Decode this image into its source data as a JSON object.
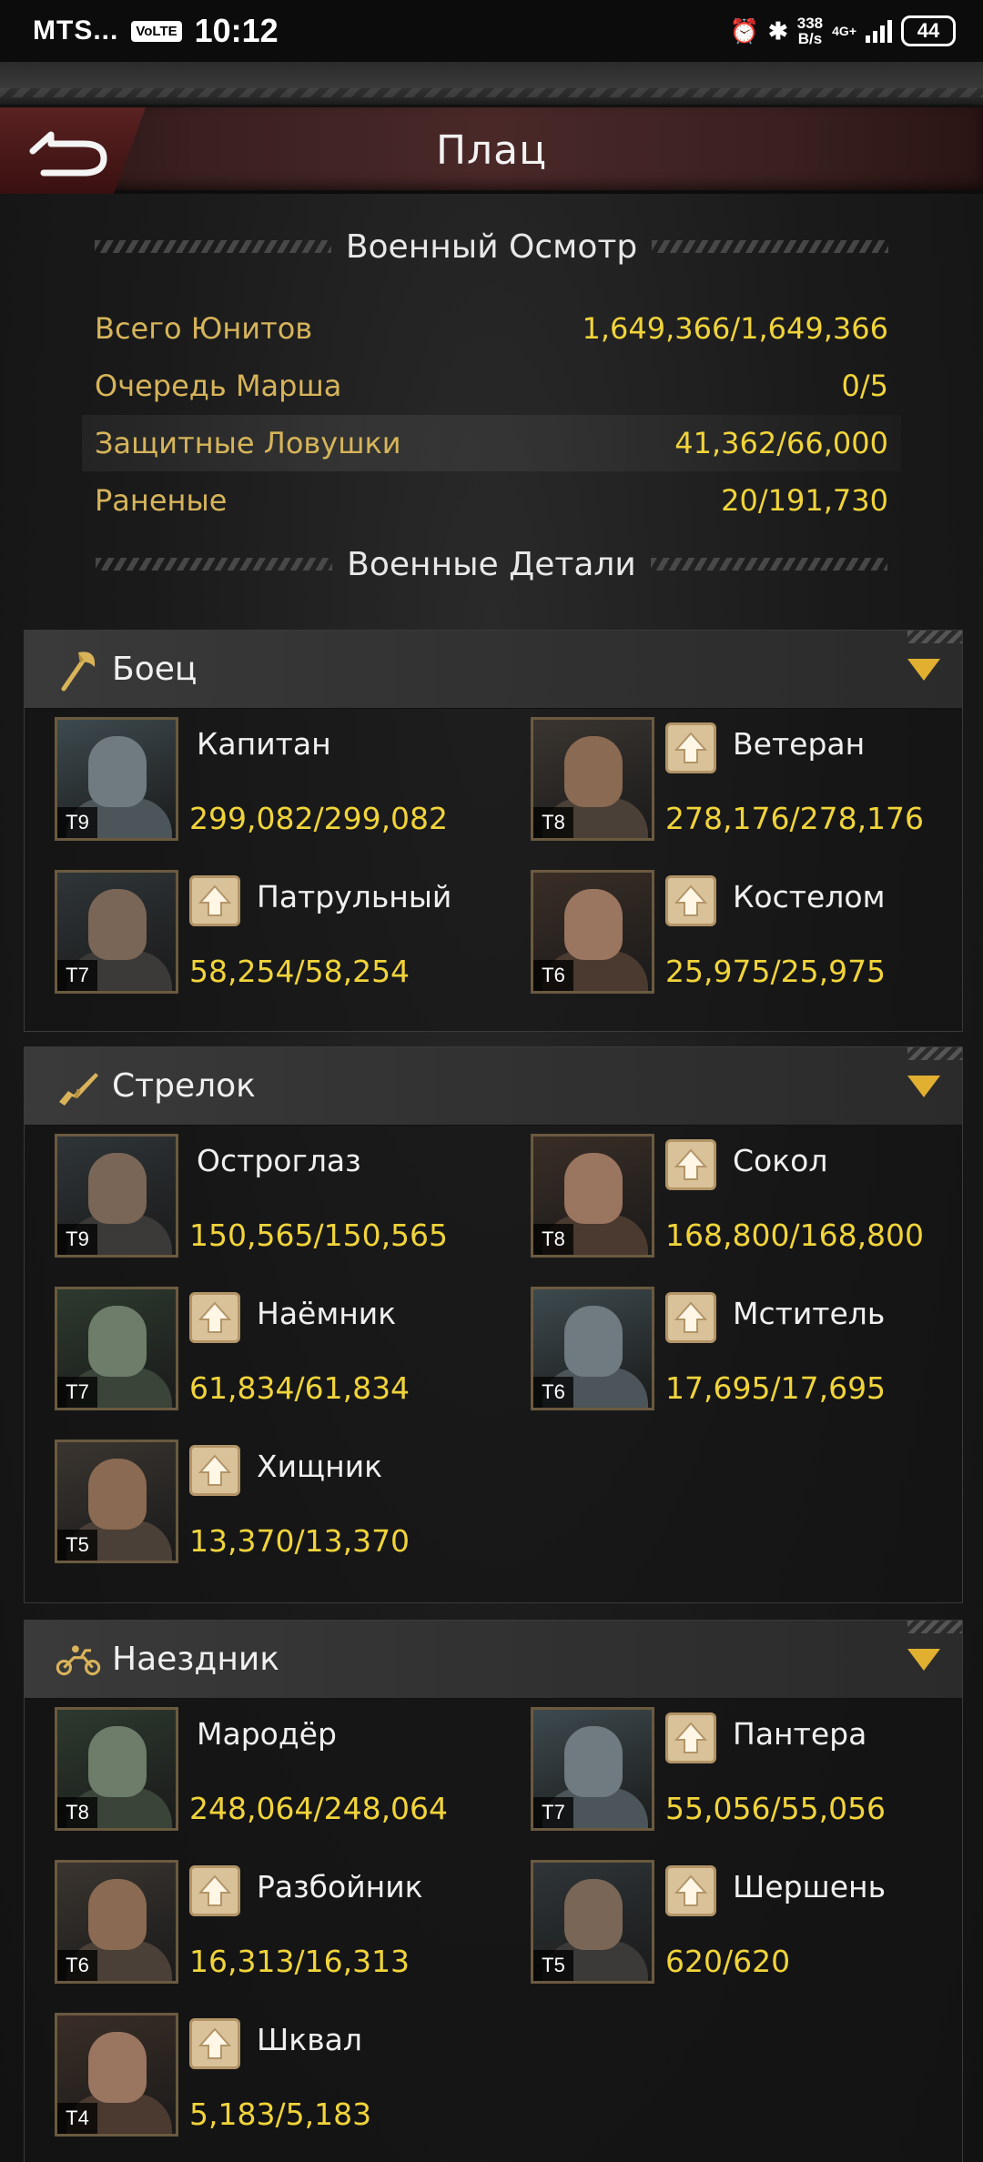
{
  "status_bar": {
    "carrier": "MTS...",
    "volte": "VoLTE",
    "time": "10:12",
    "speed_top": "338",
    "speed_bottom": "B/s",
    "net": "4G+",
    "battery": "44"
  },
  "header": {
    "title": "Плац",
    "back_icon": "back-arrow-icon"
  },
  "overview": {
    "title": "Военный Осмотр",
    "rows": [
      {
        "label": "Всего Юнитов",
        "value": "1,649,366/1,649,366"
      },
      {
        "label": "Очередь Марша",
        "value": "0/5"
      },
      {
        "label": "Защитные Ловушки",
        "value": "41,362/66,000"
      },
      {
        "label": "Раненые",
        "value": "20/191,730"
      }
    ]
  },
  "details_title": "Военные Детали",
  "categories": [
    {
      "name": "Боец",
      "icon": "axe-icon",
      "units": [
        {
          "name": "Капитан",
          "count": "299,082/299,082",
          "tier": "T9",
          "upgrade": false
        },
        {
          "name": "Ветеран",
          "count": "278,176/278,176",
          "tier": "T8",
          "upgrade": true
        },
        {
          "name": "Патрульный",
          "count": "58,254/58,254",
          "tier": "T7",
          "upgrade": true
        },
        {
          "name": "Костелом",
          "count": "25,975/25,975",
          "tier": "T6",
          "upgrade": true
        }
      ]
    },
    {
      "name": "Стрелок",
      "icon": "rifle-icon",
      "units": [
        {
          "name": "Остроглаз",
          "count": "150,565/150,565",
          "tier": "T9",
          "upgrade": false
        },
        {
          "name": "Сокол",
          "count": "168,800/168,800",
          "tier": "T8",
          "upgrade": true
        },
        {
          "name": "Наёмник",
          "count": "61,834/61,834",
          "tier": "T7",
          "upgrade": true
        },
        {
          "name": "Мститель",
          "count": "17,695/17,695",
          "tier": "T6",
          "upgrade": true
        },
        {
          "name": "Хищник",
          "count": "13,370/13,370",
          "tier": "T5",
          "upgrade": true
        }
      ]
    },
    {
      "name": "Наездник",
      "icon": "motorcycle-icon",
      "units": [
        {
          "name": "Мародёр",
          "count": "248,064/248,064",
          "tier": "T8",
          "upgrade": false
        },
        {
          "name": "Пантера",
          "count": "55,056/55,056",
          "tier": "T7",
          "upgrade": true
        },
        {
          "name": "Разбойник",
          "count": "16,313/16,313",
          "tier": "T6",
          "upgrade": true
        },
        {
          "name": "Шершень",
          "count": "620/620",
          "tier": "T5",
          "upgrade": true
        },
        {
          "name": "Шквал",
          "count": "5,183/5,183",
          "tier": "T4",
          "upgrade": true
        }
      ]
    }
  ],
  "colors": {
    "label_gold": "#d6b45a",
    "value_yellow": "#f1d43a",
    "upgrade_bg": "#d9c29a"
  }
}
